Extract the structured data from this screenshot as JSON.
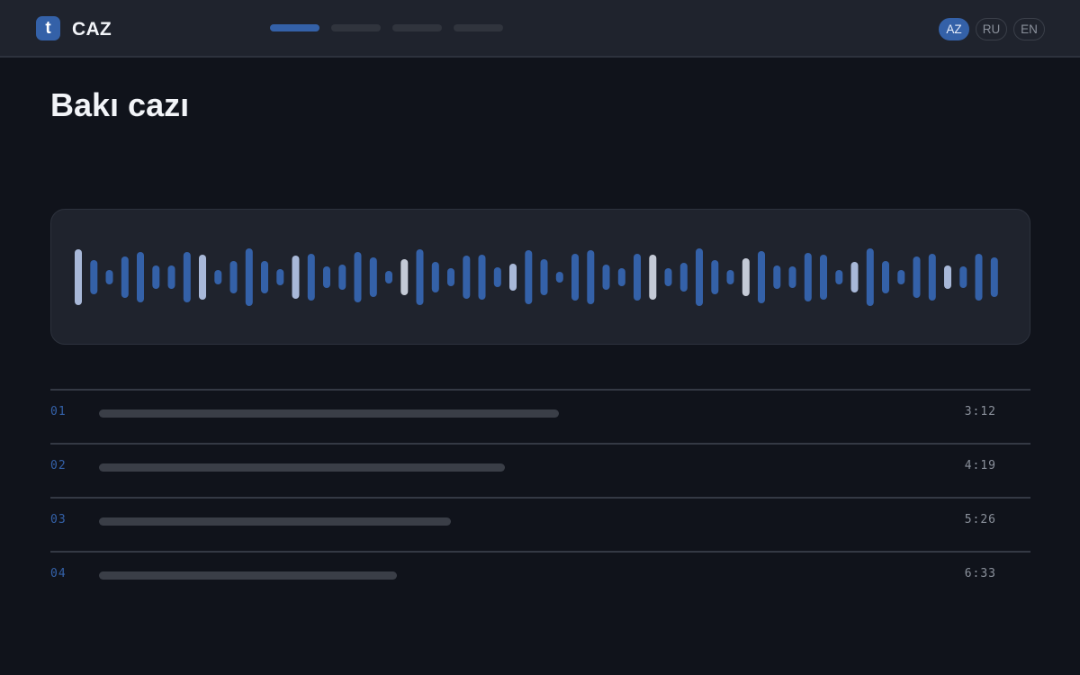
{
  "header": {
    "logo_letter": "t",
    "brand": "CAZ",
    "nav": [
      {
        "name": "nav-item-1",
        "active": true
      },
      {
        "name": "nav-item-2",
        "active": false
      },
      {
        "name": "nav-item-3",
        "active": false
      },
      {
        "name": "nav-item-4",
        "active": false
      }
    ],
    "languages": [
      {
        "code": "AZ",
        "active": true
      },
      {
        "code": "RU",
        "active": false
      },
      {
        "code": "EN",
        "active": false
      }
    ]
  },
  "page": {
    "title": "Bakı cazı"
  },
  "colors": {
    "accent": "#3461a8",
    "bar_highlight": "#a8b8d8",
    "bar_light": "#c4cad6"
  },
  "tracks": [
    {
      "number": "01",
      "duration": "3:12"
    },
    {
      "number": "02",
      "duration": "4:19"
    },
    {
      "number": "03",
      "duration": "5:26"
    },
    {
      "number": "04",
      "duration": "6:33"
    }
  ]
}
